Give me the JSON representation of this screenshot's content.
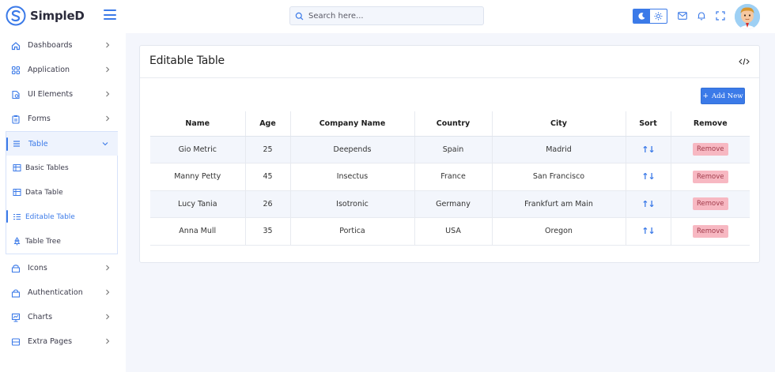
{
  "brand": {
    "name": "SimpleD"
  },
  "search": {
    "placeholder": "Search here..."
  },
  "sidebar": {
    "items": [
      {
        "label": "Dashboards",
        "icon": "home-icon"
      },
      {
        "label": "Application",
        "icon": "grid-icon"
      },
      {
        "label": "UI Elements",
        "icon": "document-icon"
      },
      {
        "label": "Forms",
        "icon": "clipboard-icon"
      },
      {
        "label": "Table",
        "icon": "table-lines-icon"
      }
    ],
    "submenu": [
      {
        "label": "Basic Tables",
        "icon": "table-icon"
      },
      {
        "label": "Data Table",
        "icon": "table-icon"
      },
      {
        "label": "Editable Table",
        "icon": "list-icon"
      },
      {
        "label": "Table Tree",
        "icon": "tree-icon"
      }
    ],
    "items_after": [
      {
        "label": "Icons",
        "icon": "box-icon"
      },
      {
        "label": "Authentication",
        "icon": "lock-icon"
      },
      {
        "label": "Charts",
        "icon": "chart-icon"
      },
      {
        "label": "Extra Pages",
        "icon": "pages-icon"
      }
    ]
  },
  "card": {
    "title": "Editable Table",
    "add_label": "Add New",
    "add_symbol": "+"
  },
  "table": {
    "headers": [
      "Name",
      "Age",
      "Company Name",
      "Country",
      "City",
      "Sort",
      "Remove"
    ],
    "rows": [
      {
        "name": "Gio Metric",
        "age": "25",
        "company": "Deepends",
        "country": "Spain",
        "city": "Madrid",
        "sort": "↑↓",
        "remove": "Remove"
      },
      {
        "name": "Manny Petty",
        "age": "45",
        "company": "Insectus",
        "country": "France",
        "city": "San Francisco",
        "sort": "↑↓",
        "remove": "Remove"
      },
      {
        "name": "Lucy Tania",
        "age": "26",
        "company": "Isotronic",
        "country": "Germany",
        "city": "Frankfurt am Main",
        "sort": "↑↓",
        "remove": "Remove"
      },
      {
        "name": "Anna Mull",
        "age": "35",
        "company": "Portica",
        "country": "USA",
        "city": "Oregon",
        "sort": "↑↓",
        "remove": "Remove"
      }
    ]
  },
  "colors": {
    "accent": "#3b7ae8",
    "remove_bg": "#f7b8c2",
    "page_bg": "#f4f6fc"
  }
}
